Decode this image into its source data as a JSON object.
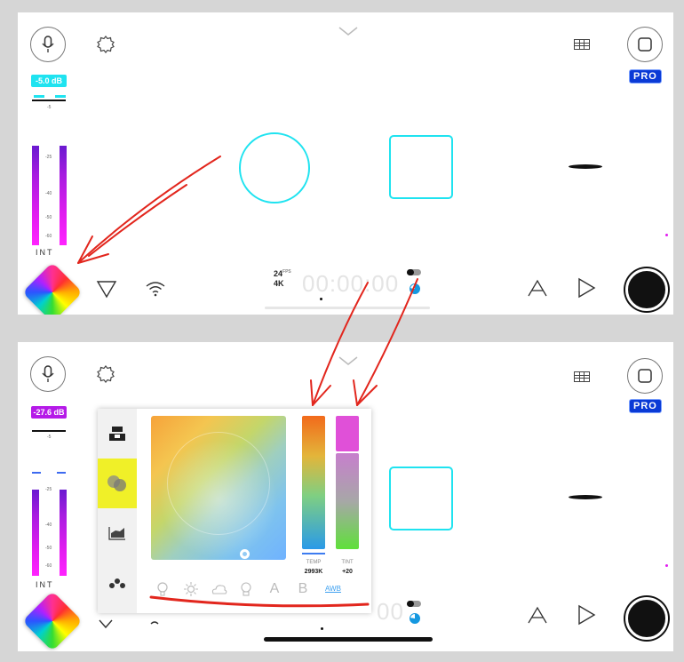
{
  "colors": {
    "accent_cyan": "#1fe3f0",
    "pro_badge": "#0a3ad6",
    "meter_magenta": "#e21df0",
    "annotation_red": "#e2261d",
    "selected_tab": "#f0f028"
  },
  "top_panel": {
    "pro_badge": "PRO",
    "meter_value": "-5.0 dB",
    "meter_ticks": [
      "-5",
      "-25",
      "-40",
      "-50",
      "-60"
    ],
    "input_label": "INT",
    "fps_value": "24",
    "fps_unit": "FPS",
    "resolution": "4K",
    "timecode": "00:00:00"
  },
  "bottom_panel": {
    "pro_badge": "PRO",
    "meter_value": "-27.6 dB",
    "meter_ticks": [
      "-5",
      "-25",
      "-40",
      "-50",
      "-60"
    ],
    "input_label": "INT",
    "timecode": "00",
    "white_balance": {
      "temp_label": "TEMP",
      "temp_value": "2993K",
      "tint_label": "TINT",
      "tint_value": "+20",
      "presets": [
        "A",
        "B"
      ],
      "awb_label": "AWB",
      "selected_tab": "color-balance"
    }
  }
}
